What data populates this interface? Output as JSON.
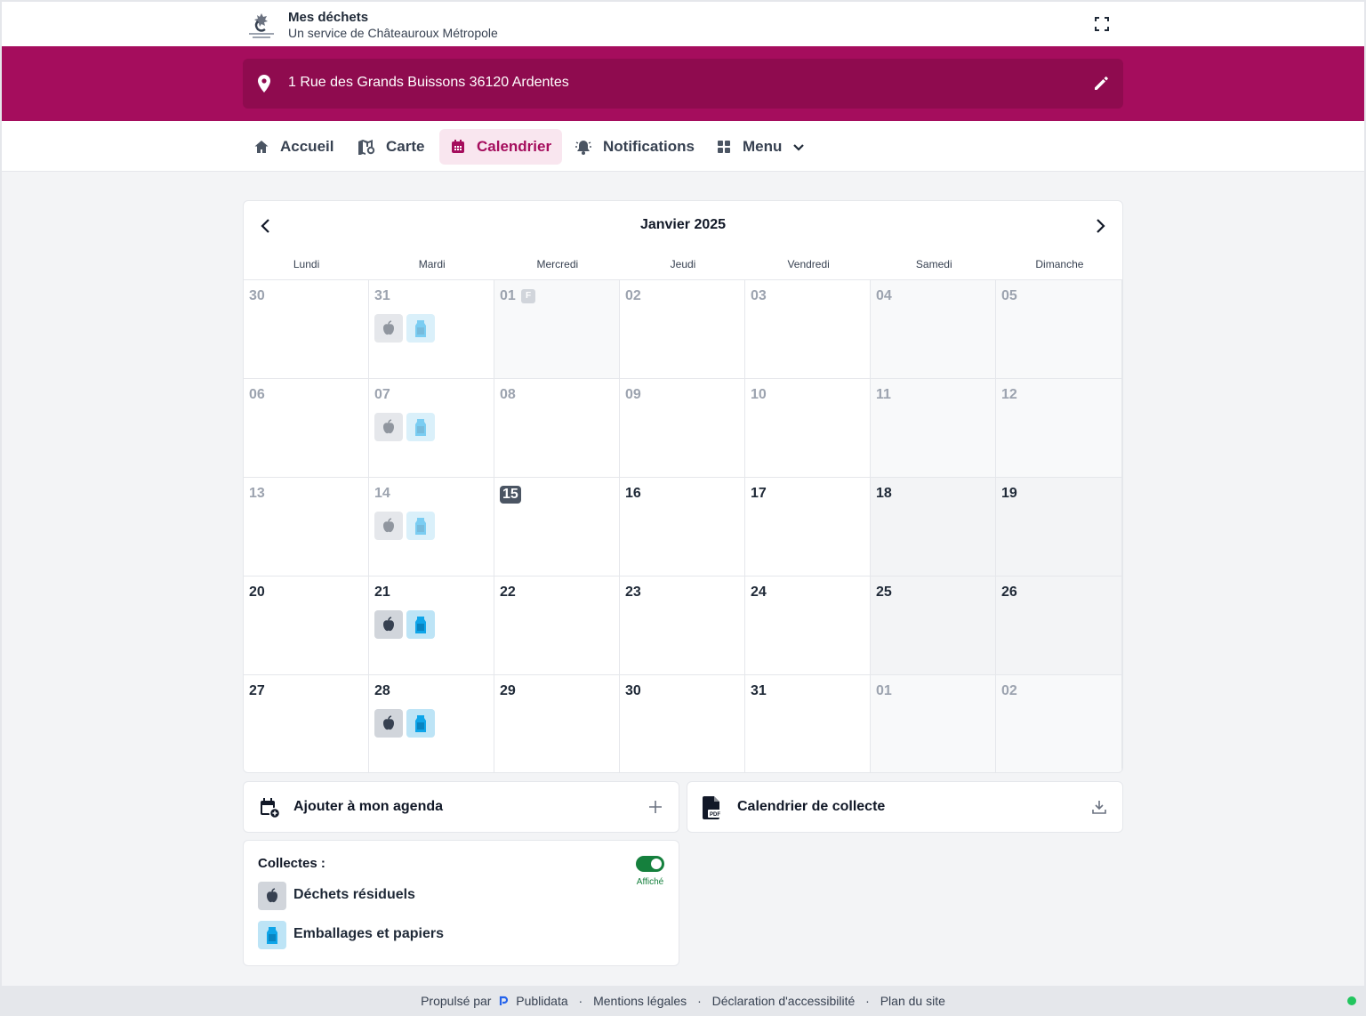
{
  "header": {
    "title": "Mes déchets",
    "subtitle": "Un service de Châteauroux Métropole",
    "fullscreen_icon": "fullscreen-icon"
  },
  "address": {
    "text": "1 Rue des Grands Buissons 36120 Ardentes",
    "icon": "map-pin-icon",
    "edit_icon": "pencil-icon"
  },
  "nav": {
    "accueil": "Accueil",
    "carte": "Carte",
    "calendrier": "Calendrier",
    "notifications": "Notifications",
    "menu": "Menu"
  },
  "colors": {
    "brand": "#a50d5d",
    "brand_dark": "#8f0b4f",
    "residuel": "#d1d5db",
    "emballages": "#bde4f6",
    "toggle_on": "#15803d"
  },
  "calendar": {
    "title": "Janvier 2025",
    "weekdays": [
      "Lundi",
      "Mardi",
      "Mercredi",
      "Jeudi",
      "Vendredi",
      "Samedi",
      "Dimanche"
    ],
    "holiday_badge": "F",
    "weeks": [
      [
        {
          "day": "30",
          "muted": true
        },
        {
          "day": "31",
          "muted": true,
          "collectes": [
            "residuel",
            "emballages"
          ]
        },
        {
          "day": "01",
          "muted": true,
          "holiday": true
        },
        {
          "day": "02",
          "muted": true
        },
        {
          "day": "03",
          "muted": true
        },
        {
          "day": "04",
          "muted": true
        },
        {
          "day": "05",
          "muted": true
        }
      ],
      [
        {
          "day": "06",
          "muted": true
        },
        {
          "day": "07",
          "muted": true,
          "collectes": [
            "residuel",
            "emballages"
          ]
        },
        {
          "day": "08",
          "muted": true
        },
        {
          "day": "09",
          "muted": true
        },
        {
          "day": "10",
          "muted": true
        },
        {
          "day": "11",
          "muted": true
        },
        {
          "day": "12",
          "muted": true
        }
      ],
      [
        {
          "day": "13",
          "muted": true
        },
        {
          "day": "14",
          "muted": true,
          "collectes": [
            "residuel",
            "emballages"
          ]
        },
        {
          "day": "15",
          "today": true
        },
        {
          "day": "16"
        },
        {
          "day": "17"
        },
        {
          "day": "18"
        },
        {
          "day": "19"
        }
      ],
      [
        {
          "day": "20"
        },
        {
          "day": "21",
          "collectes": [
            "residuel",
            "emballages"
          ]
        },
        {
          "day": "22"
        },
        {
          "day": "23"
        },
        {
          "day": "24"
        },
        {
          "day": "25"
        },
        {
          "day": "26"
        }
      ],
      [
        {
          "day": "27"
        },
        {
          "day": "28",
          "collectes": [
            "residuel",
            "emballages"
          ]
        },
        {
          "day": "29"
        },
        {
          "day": "30"
        },
        {
          "day": "31"
        },
        {
          "day": "01",
          "muted": true
        },
        {
          "day": "02",
          "muted": true
        }
      ]
    ]
  },
  "actions": {
    "agenda": "Ajouter à mon agenda",
    "pdf": "Calendrier de collecte"
  },
  "legend": {
    "title": "Collectes :",
    "toggle_label": "Affiché",
    "items": [
      {
        "label": "Déchets résiduels",
        "icon": "apple-icon"
      },
      {
        "label": "Emballages et papiers",
        "icon": "milk-carton-icon"
      }
    ]
  },
  "footer": {
    "powered": "Propulsé par",
    "brand": "Publidata",
    "links": [
      "Mentions légales",
      "Déclaration d'accessibilité",
      "Plan du site"
    ]
  }
}
